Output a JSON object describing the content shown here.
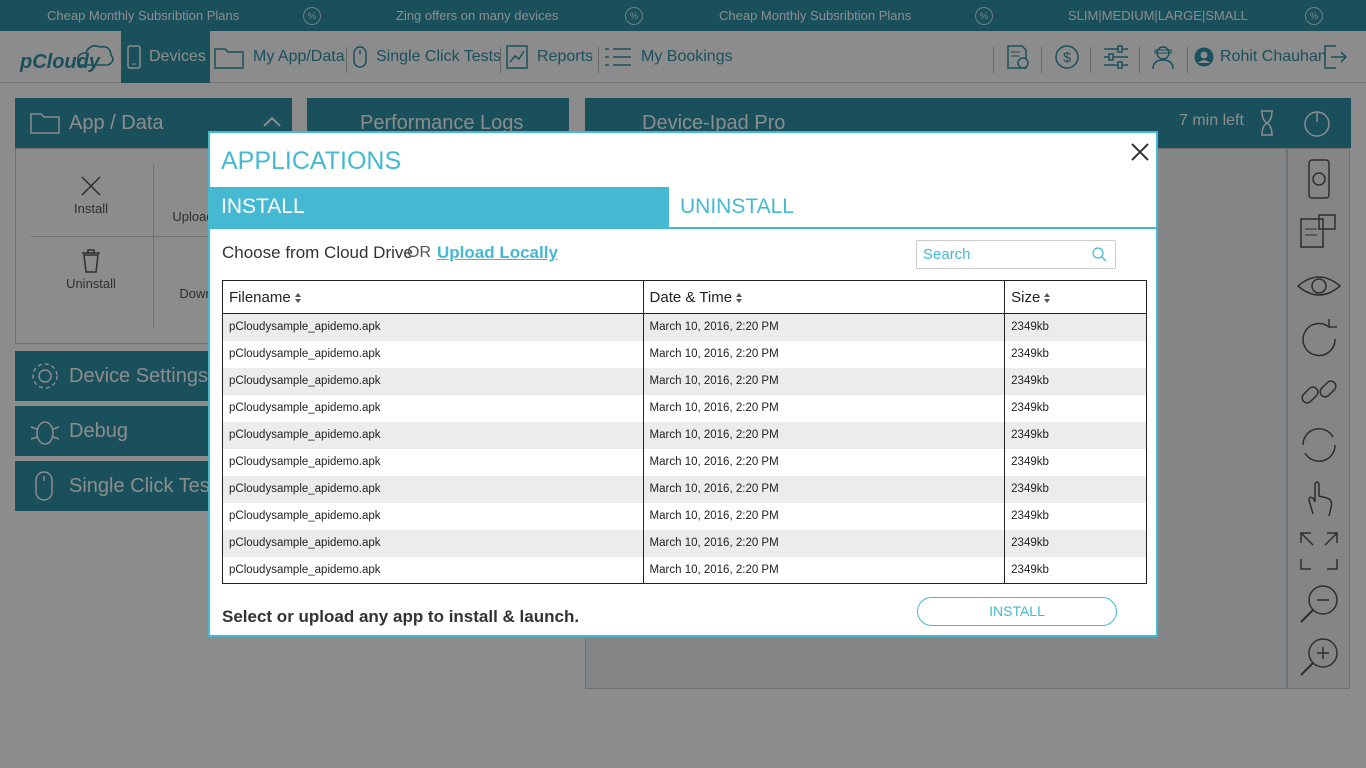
{
  "promo": {
    "items": [
      "Cheap Monthly Subsribtion Plans",
      "Zing offers on many devices",
      "Cheap Monthly Subsribtion Plans",
      "SLIM|MEDIUM|LARGE|SMALL"
    ],
    "badge": "%"
  },
  "nav": {
    "logo": "pCloudy",
    "items": [
      {
        "label": "Devices",
        "icon": "phone-icon"
      },
      {
        "label": "My App/Data",
        "icon": "folder-icon"
      },
      {
        "label": "Single Click Tests",
        "icon": "mouse-icon"
      },
      {
        "label": "Reports",
        "icon": "report-icon"
      },
      {
        "label": "My Bookings",
        "icon": "list-icon"
      }
    ],
    "user": "Rohit Chauhan"
  },
  "background": {
    "app_data_title": "App / Data",
    "perf_logs_title": "Performance Logs",
    "device_title": "Device-Ipad Pro",
    "time_left": "7 min left",
    "app_actions": {
      "install": "Install",
      "upload": "Upload",
      "uninstall": "Uninstall",
      "download": "Down"
    },
    "side": {
      "device_settings": "Device Settings",
      "debug": "Debug",
      "single_click": "Single Click Tests"
    }
  },
  "modal": {
    "title": "APPLICATIONS",
    "tabs": {
      "install": "INSTALL",
      "uninstall": "UNINSTALL"
    },
    "choose_label": "Choose from Cloud Drive",
    "or_label": "OR",
    "upload_link": "Upload Locally",
    "search_placeholder": "Search",
    "columns": {
      "filename": "Filename",
      "datetime": "Date & Time",
      "size": "Size"
    },
    "rows": [
      {
        "file": "pCloudysample_apidemo.apk",
        "date": "March 10, 2016, 2:20 PM",
        "size": "2349kb"
      },
      {
        "file": "pCloudysample_apidemo.apk",
        "date": "March 10, 2016, 2:20 PM",
        "size": "2349kb"
      },
      {
        "file": "pCloudysample_apidemo.apk",
        "date": "March 10, 2016, 2:20 PM",
        "size": "2349kb"
      },
      {
        "file": "pCloudysample_apidemo.apk",
        "date": "March 10, 2016, 2:20 PM",
        "size": "2349kb"
      },
      {
        "file": "pCloudysample_apidemo.apk",
        "date": "March 10, 2016, 2:20 PM",
        "size": "2349kb"
      },
      {
        "file": "pCloudysample_apidemo.apk",
        "date": "March 10, 2016, 2:20 PM",
        "size": "2349kb"
      },
      {
        "file": "pCloudysample_apidemo.apk",
        "date": "March 10, 2016, 2:20 PM",
        "size": "2349kb"
      },
      {
        "file": "pCloudysample_apidemo.apk",
        "date": "March 10, 2016, 2:20 PM",
        "size": "2349kb"
      },
      {
        "file": "pCloudysample_apidemo.apk",
        "date": "March 10, 2016, 2:20 PM",
        "size": "2349kb"
      },
      {
        "file": "pCloudysample_apidemo.apk",
        "date": "March 10, 2016, 2:20 PM",
        "size": "2349kb"
      }
    ],
    "footer_text": "Select or upload any app to install & launch.",
    "install_button": "INSTALL"
  },
  "colors": {
    "brand": "#2f93a8",
    "accent": "#45b9d2"
  }
}
